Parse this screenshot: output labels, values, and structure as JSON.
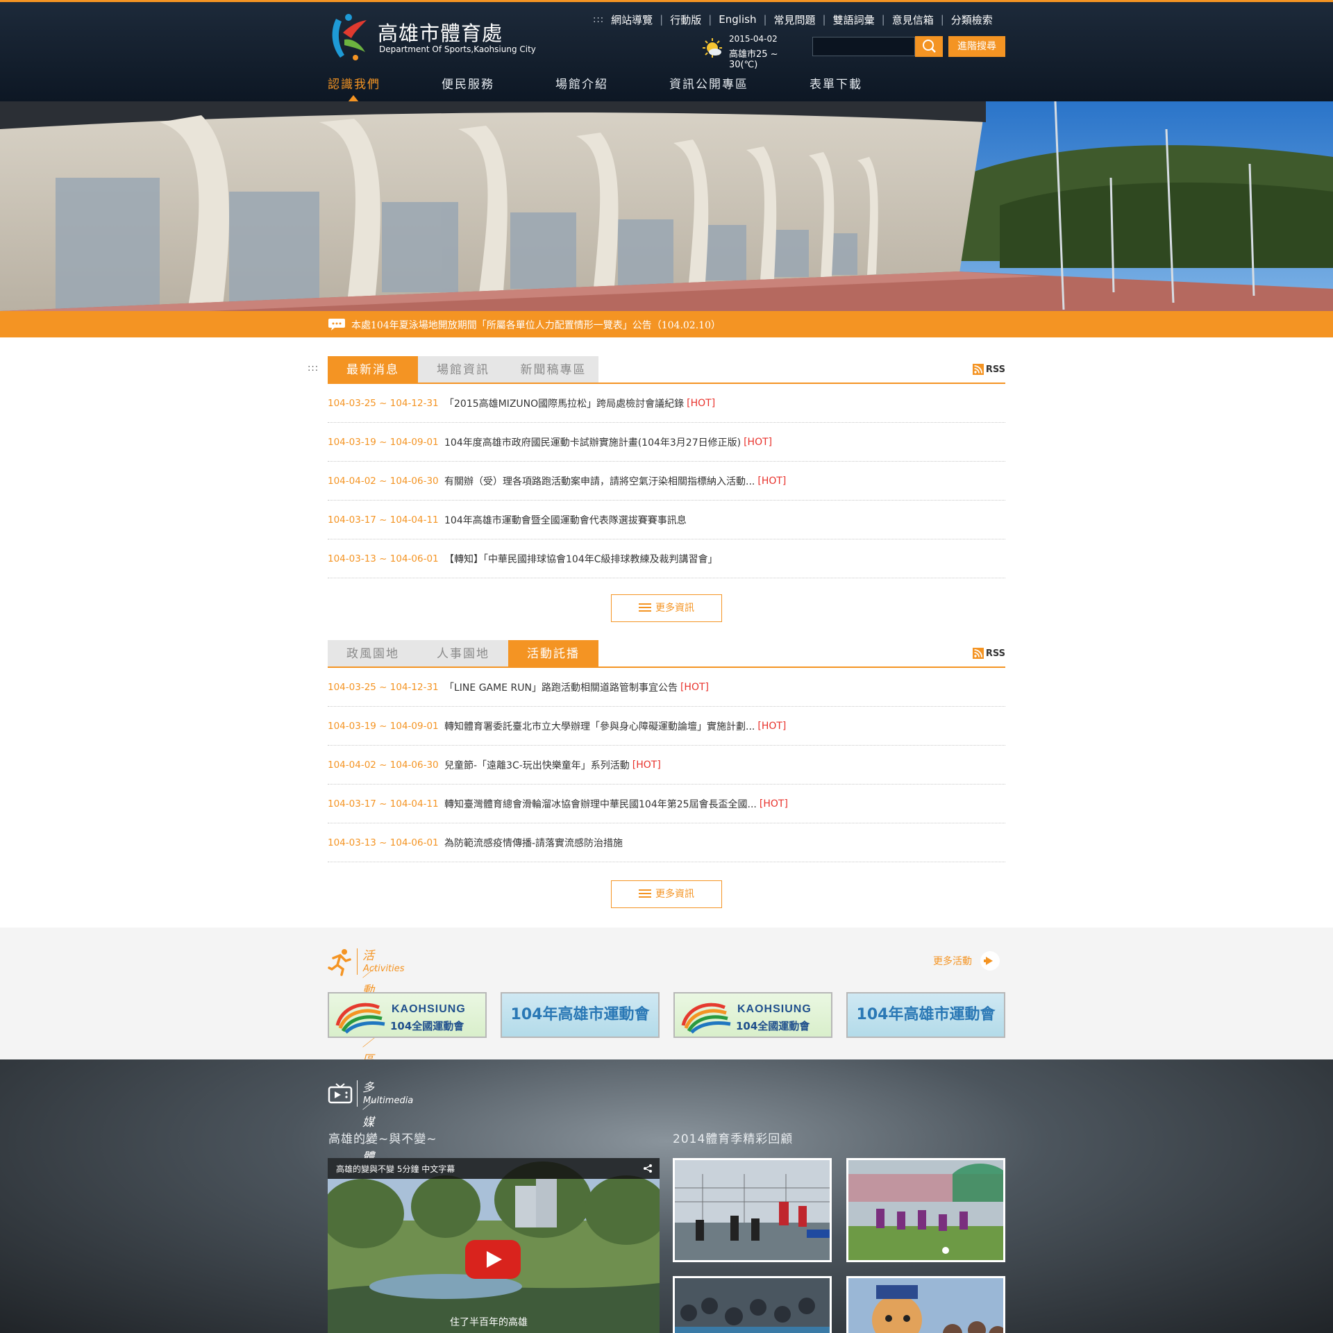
{
  "header": {
    "logo_title": "高雄市體育處",
    "logo_subtitle": "Department Of Sports,Kaohsiung City",
    "top_links_prefix": ":::",
    "top_links": [
      "網站導覽",
      "行動版",
      "English",
      "常見問題",
      "雙語詞彙",
      "意見信箱",
      "分類檢索"
    ],
    "weather": {
      "date": "2015-04-02",
      "temp": "高雄市25 ~ 30(℃)",
      "icon": "sun-cloud-icon"
    },
    "search": {
      "placeholder": "",
      "button_icon": "search-icon",
      "advanced_label": "進階搜尋"
    },
    "nav": [
      "認識我們",
      "便民服務",
      "場館介紹",
      "資訊公開專區",
      "表單下載"
    ],
    "nav_active_index": 0
  },
  "announcement": {
    "text": "本處104年夏泳場地開放期間「所屬各單位人力配置情形一覽表」公告（104.02.10）"
  },
  "side_marker": ":::",
  "news_panel_1": {
    "tabs": [
      "最新消息",
      "場館資訊",
      "新聞稿專區"
    ],
    "active_tab": 0,
    "rss_label": "RSS",
    "items": [
      {
        "date": "104-03-25 ~ 104-12-31",
        "title": "「2015高雄MIZUNO國際馬拉松」跨局處檢討會議紀錄",
        "hot": "[HOT]"
      },
      {
        "date": "104-03-19 ~ 104-09-01",
        "title": "104年度高雄市政府國民運動卡試辦實施計畫(104年3月27日修正版)",
        "hot": "[HOT]"
      },
      {
        "date": "104-04-02 ~ 104-06-30",
        "title": "有關辦（受）理各項路跑活動案申請，請將空氣汙染相關指標納入活動...",
        "hot": "[HOT]"
      },
      {
        "date": "104-03-17 ~ 104-04-11",
        "title": "104年高雄市運動會暨全國運動會代表隊選拔賽賽事訊息",
        "hot": ""
      },
      {
        "date": "104-03-13 ~ 104-06-01",
        "title": "【轉知】「中華民國排球協會104年C級排球教練及裁判講習會」",
        "hot": ""
      }
    ],
    "more_label": "更多資訊"
  },
  "news_panel_2": {
    "tabs": [
      "政風園地",
      "人事園地",
      "活動託播"
    ],
    "active_tab": 2,
    "rss_label": "RSS",
    "items": [
      {
        "date": "104-03-25 ~ 104-12-31",
        "title": "「LINE GAME RUN」路跑活動相關道路管制事宜公告",
        "hot": "[HOT]"
      },
      {
        "date": "104-03-19 ~ 104-09-01",
        "title": "轉知體育署委託臺北市立大學辦理「參與身心障礙運動論壇」實施計劃...",
        "hot": "[HOT]"
      },
      {
        "date": "104-04-02 ~ 104-06-30",
        "title": "兒童節-「遠離3C-玩出快樂童年」系列活動",
        "hot": "[HOT]"
      },
      {
        "date": "104-03-17 ~ 104-04-11",
        "title": "轉知臺灣體育總會滑輪溜冰協會辦理中華民國104年第25屆會長盃全國...",
        "hot": "[HOT]"
      },
      {
        "date": "104-03-13 ~ 104-06-01",
        "title": "為防範流感疫情傳播-請落實流感防治措施",
        "hot": ""
      }
    ],
    "more_label": "更多資訊"
  },
  "activities": {
    "title": "活／動／特／區",
    "subtitle": "Activities",
    "icon": "runner-icon",
    "more_label": "更多活動",
    "banners": [
      {
        "type": "kaohsiung",
        "brand": "KAOHSIUNG",
        "sub": "104全國運動會"
      },
      {
        "type": "city",
        "text": "104年高雄市運動會"
      },
      {
        "type": "kaohsiung",
        "brand": "KAOHSIUNG",
        "sub": "104全國運動會"
      },
      {
        "type": "city",
        "text": "104年高雄市運動會"
      }
    ]
  },
  "multimedia": {
    "title": "多／媒／體／專／區",
    "subtitle": "Multimedia",
    "icon": "tv-icon",
    "video_heading": "高雄的變~與不變~",
    "video_title": "高雄的變與不變 5分鐘 中文字幕",
    "video_caption": "住了半百年的高雄",
    "gallery_heading": "2014體育季精彩回顧"
  },
  "colors": {
    "accent": "#f49423",
    "header_bg": "#0d1724",
    "hot": "#e8312b",
    "date": "#f49423"
  }
}
